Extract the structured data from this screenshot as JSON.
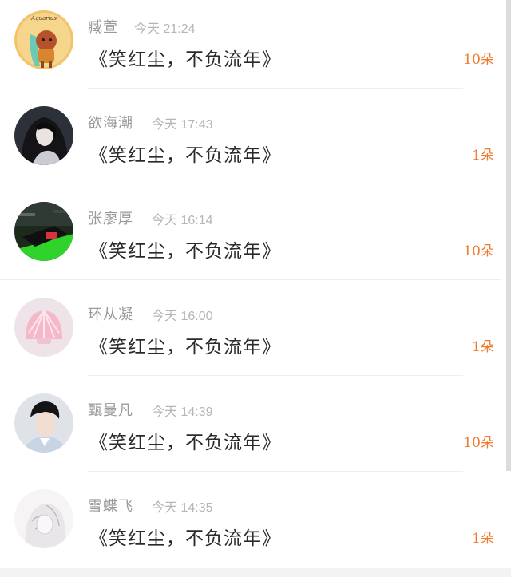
{
  "messages": [
    {
      "name": "臧萱",
      "time": "今天 21:24",
      "text": "《笑红尘，不负流年》",
      "gift": "10朵",
      "avatar": "aquarius-cartoon-avatar"
    },
    {
      "name": "欲海潮",
      "time": "今天 17:43",
      "text": "《笑红尘，不负流年》",
      "gift": "1朵",
      "avatar": "dark-hair-girl-avatar"
    },
    {
      "name": "张廖厚",
      "time": "今天 16:14",
      "text": "《笑红尘，不负流年》",
      "gift": "10朵",
      "avatar": "neon-car-avatar"
    },
    {
      "name": "环从凝",
      "time": "今天 16:00",
      "text": "《笑红尘，不负流年》",
      "gift": "1朵",
      "avatar": "pink-shell-avatar"
    },
    {
      "name": "甄曼凡",
      "time": "今天 14:39",
      "text": "《笑红尘，不负流年》",
      "gift": "10朵",
      "avatar": "young-man-avatar"
    },
    {
      "name": "雪蝶飞",
      "time": "今天 14:35",
      "text": "《笑红尘，不负流年》",
      "gift": "1朵",
      "avatar": "sketch-girl-avatar"
    }
  ],
  "avatar_badge": "Aquarius",
  "colors": {
    "gift": "#f07a2e",
    "name": "#9a9a9a",
    "time": "#b5b5b5",
    "message": "#2a2a2a"
  }
}
